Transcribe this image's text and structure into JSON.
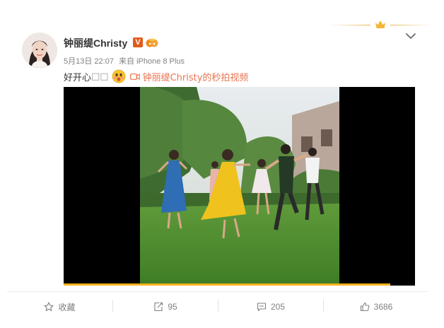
{
  "post": {
    "author": "钟丽缇Christy",
    "verified_badge": "V",
    "timestamp": "5月13日 22:07",
    "source_prefix": "来自",
    "device": "iPhone 8 Plus",
    "text": "好开心",
    "text_boxes": "□□",
    "video_link": "钟丽缇Christy的秒拍视频",
    "video_progress": 0.93
  },
  "actions": {
    "favorite": "收藏",
    "repost": "95",
    "comment": "205",
    "like": "3686"
  },
  "colors": {
    "link": "#eb7350",
    "badge": "#e25a1a",
    "progress": "#f6b21b",
    "muted": "#808080"
  },
  "icons": [
    "crown-icon",
    "chevron-down-icon",
    "verified-icon",
    "vip-icon",
    "emoji-icon",
    "video-icon",
    "star-icon",
    "repost-icon",
    "comment-icon",
    "thumbs-up-icon"
  ]
}
